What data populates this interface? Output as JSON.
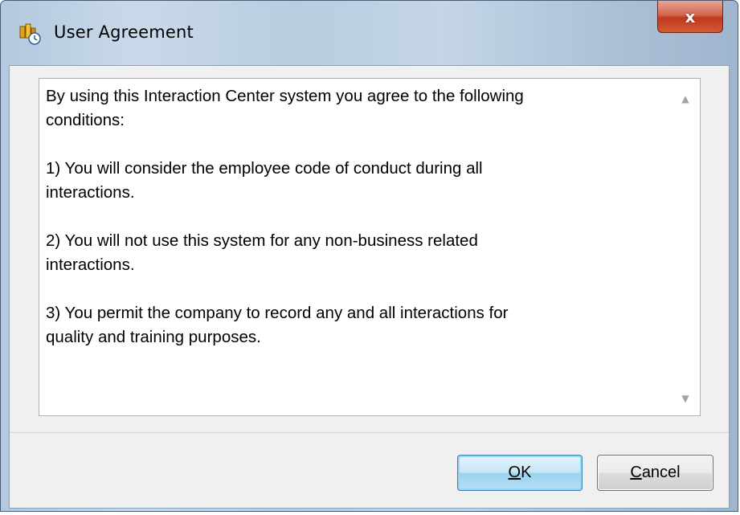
{
  "window": {
    "title": "User Agreement",
    "close_label": "x"
  },
  "agreement": {
    "text": "By using this Interaction Center system you agree to the following\nconditions:\n\n1) You will consider the employee code of conduct during all\ninteractions.\n\n2) You will not use this system for any non-business related\ninteractions.\n\n3) You permit the company to record any and all interactions for\nquality and training purposes."
  },
  "scrollbar": {
    "up_arrow": "▲",
    "down_arrow": "▼"
  },
  "buttons": {
    "ok_mnemonic": "O",
    "ok_rest": "K",
    "cancel_mnemonic": "C",
    "cancel_rest": "ancel"
  },
  "icons": {
    "app": "interaction-center-app-icon",
    "close": "close-icon"
  },
  "colors": {
    "close_button": "#c0391d",
    "ok_border": "#3c7fb1",
    "dialog_background": "#f0f0f0"
  }
}
